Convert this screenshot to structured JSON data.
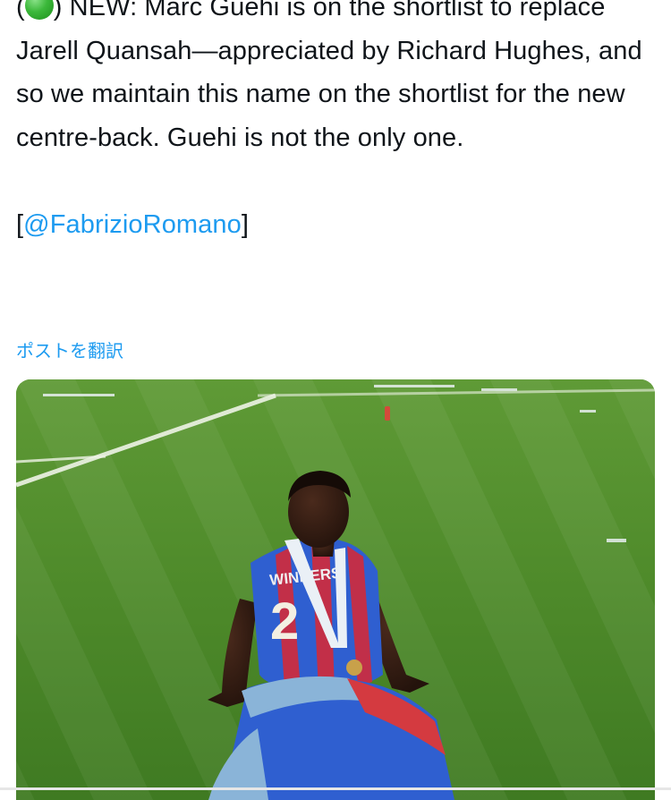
{
  "tweet": {
    "open_paren": "(",
    "status_emoji": "green-circle",
    "body_after_emoji": ") NEW: Marc Guehi is on the shortlist to replace Jarell Quansah—appreciated by Richard Hughes, and so we maintain this name on the shortlist for the new centre-back. Guehi is not the only one.",
    "bracket_open": "[",
    "mention": "@FabrizioRomano",
    "bracket_close": "]",
    "translate_label": "ポストを翻訳"
  },
  "media": {
    "shirt_text": "WINNERS",
    "shirt_number": "2"
  },
  "colors": {
    "text": "#0f1419",
    "link": "#1d9bf0",
    "grass": "#4f8a2b",
    "shirt_blue": "#2f5fd0",
    "shirt_red": "#d22a3a"
  }
}
